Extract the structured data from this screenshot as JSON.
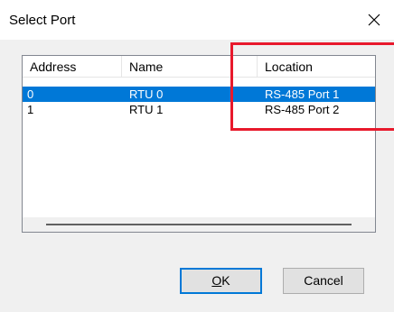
{
  "window": {
    "title": "Select Port",
    "close_icon": "close-icon"
  },
  "list": {
    "columns": [
      {
        "label": "Address"
      },
      {
        "label": "Name"
      },
      {
        "label": "Location"
      }
    ],
    "rows": [
      {
        "address": "0",
        "name": "RTU 0",
        "location": "RS-485 Port 1",
        "selected": true
      },
      {
        "address": "1",
        "name": "RTU 1",
        "location": "RS-485 Port 2",
        "selected": false
      }
    ]
  },
  "buttons": {
    "ok_first": "O",
    "ok_rest": "K",
    "cancel": "Cancel"
  },
  "colors": {
    "selection": "#0078d7",
    "highlight_annotation": "#e8192c"
  }
}
